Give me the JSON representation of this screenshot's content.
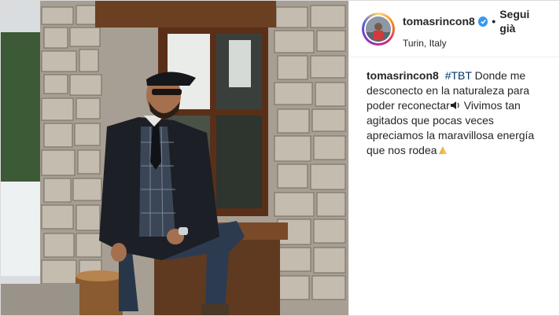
{
  "post": {
    "username": "tomasrincon8",
    "follow_label": "Segui già",
    "separator": "•",
    "location": "Turin, Italy",
    "verified_icon": "verified-badge-icon",
    "caption": {
      "username": "tomasrincon8",
      "hashtag": "#TBT",
      "text_part1": "Donde me desconecto en la naturaleza para poder reconectar",
      "text_part2": "Vivimos tan agitados que pocas veces apreciamos la maravillosa energía que nos rodea",
      "emoji_1": "speaker-emoji-icon",
      "emoji_2": "folded-hands-emoji-icon"
    },
    "colors": {
      "link": "#003569",
      "verified": "#3897f0",
      "text": "#262626"
    }
  }
}
